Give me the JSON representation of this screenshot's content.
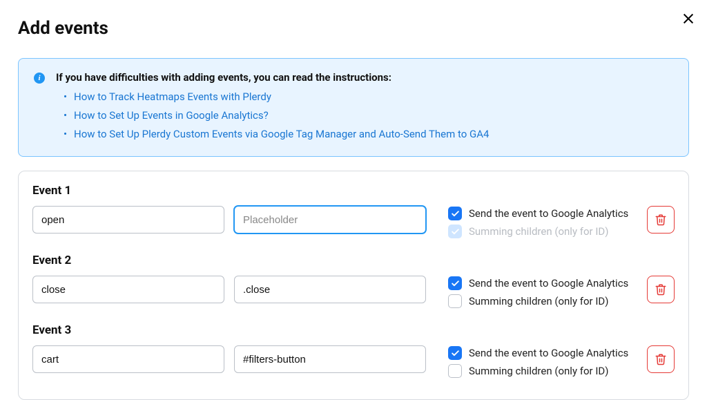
{
  "modal": {
    "title": "Add events"
  },
  "info": {
    "heading": "If you have difficulties with adding events, you can read the instructions:",
    "links": [
      "How to Track Heatmaps Events with Plerdy",
      "How to Set Up Events in Google Analytics?",
      "How to Set Up Plerdy Custom Events via Google Tag Manager and Auto-Send Them to GA4"
    ]
  },
  "labels": {
    "send_ga": "Send the event to Google Analytics",
    "summing": "Summing children (only for ID)",
    "placeholder": "Placeholder"
  },
  "events": [
    {
      "title": "Event 1",
      "name": "open",
      "selector": "",
      "selector_focused": true,
      "send_ga": true,
      "summing": true,
      "summing_disabled": true
    },
    {
      "title": "Event 2",
      "name": "close",
      "selector": ".close",
      "selector_focused": false,
      "send_ga": true,
      "summing": false,
      "summing_disabled": false
    },
    {
      "title": "Event 3",
      "name": "cart",
      "selector": "#filters-button",
      "selector_focused": false,
      "send_ga": true,
      "summing": false,
      "summing_disabled": false
    }
  ]
}
